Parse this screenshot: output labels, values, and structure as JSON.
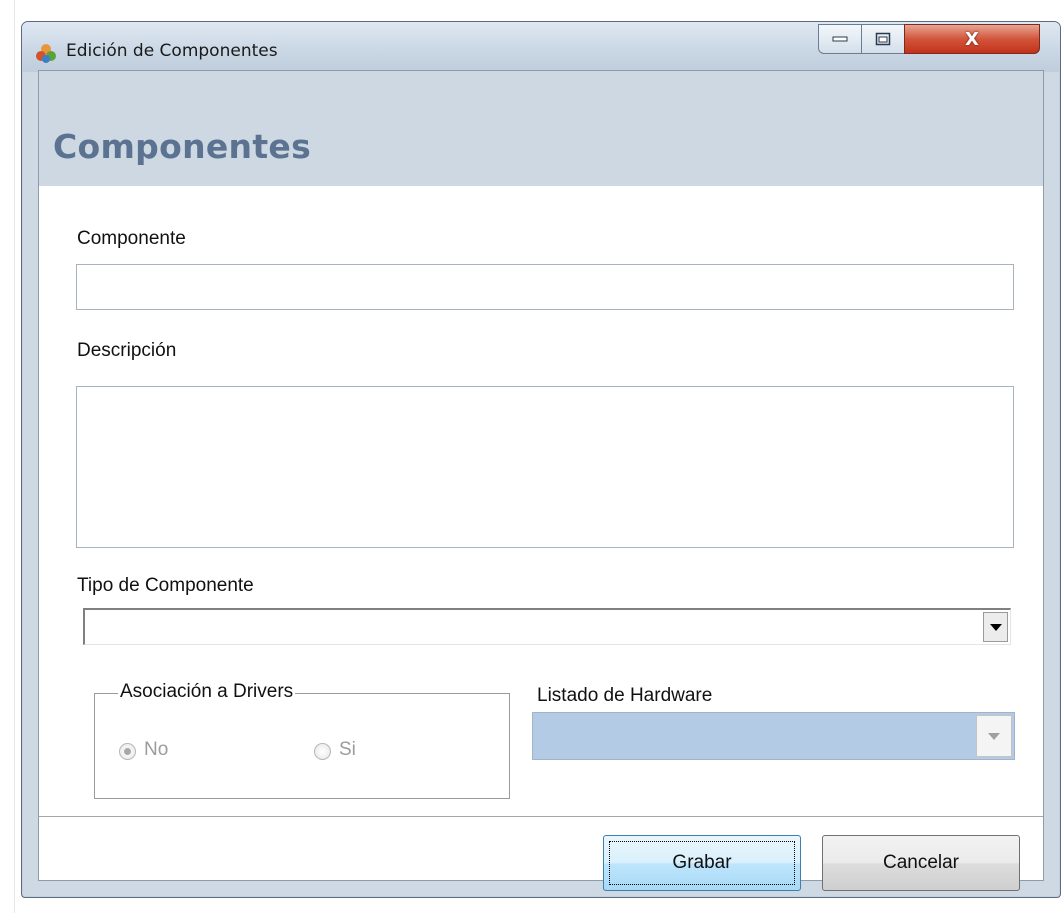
{
  "window": {
    "title": "Edición de Componentes",
    "close_glyph": "X"
  },
  "header": {
    "title": "Componentes"
  },
  "form": {
    "componente_label": "Componente",
    "componente_value": "",
    "descripcion_label": "Descripción",
    "descripcion_value": "",
    "tipo_label": "Tipo de Componente",
    "tipo_value": "",
    "drivers_group_title": "Asociación a Drivers",
    "radio_no_label": "No",
    "radio_si_label": "Si",
    "radio_selected": "No",
    "hardware_label": "Listado de Hardware",
    "hardware_value": ""
  },
  "buttons": {
    "grabar": "Grabar",
    "cancelar": "Cancelar"
  },
  "colors": {
    "header_band": "#cdd8e3",
    "header_title": "#5b7290",
    "hardware_combo": "#b4cbe6",
    "primary_button_border": "#3c7fb1"
  },
  "icons": {
    "app": "app-icon",
    "minimize": "minimize-icon",
    "maximize": "maximize-icon",
    "close": "close-icon"
  }
}
